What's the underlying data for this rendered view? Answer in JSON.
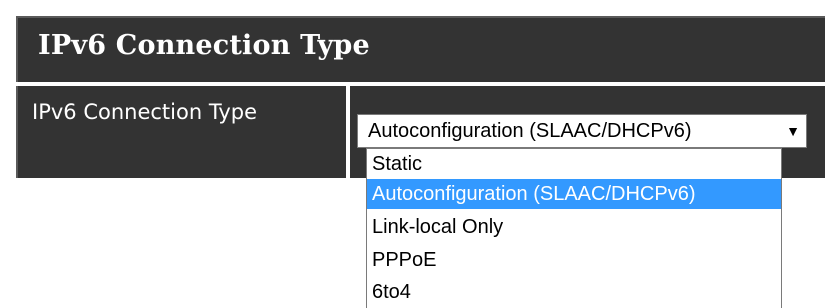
{
  "section": {
    "title": "IPv6 Connection Type"
  },
  "field": {
    "label": "IPv6 Connection Type",
    "selected_value": "Autoconfiguration (SLAAC/DHCPv6)",
    "arrow_icon": "triangle-down-icon",
    "options": [
      "Static",
      "Autoconfiguration (SLAAC/DHCPv6)",
      "Link-local Only",
      "PPPoE",
      "6to4"
    ],
    "highlighted_option": "Autoconfiguration (SLAAC/DHCPv6)"
  },
  "colors": {
    "panel_background": "#333333",
    "text_on_panel": "#ffffff",
    "highlight": "#3399ff"
  }
}
